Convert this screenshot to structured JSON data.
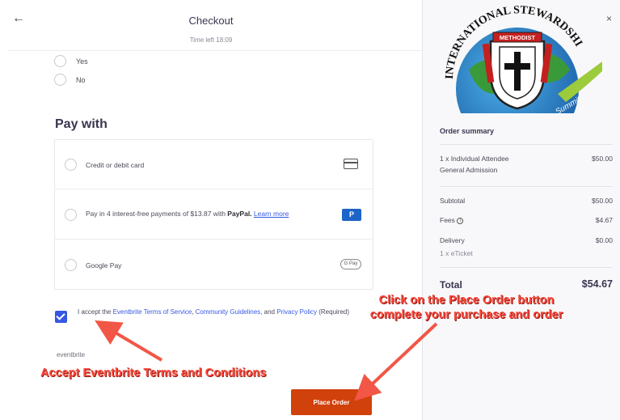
{
  "header": {
    "title": "Checkout",
    "time_left": "Time left 18:09",
    "back_icon": "arrow-left-icon"
  },
  "question": {
    "options": [
      "Yes",
      "No"
    ]
  },
  "payment": {
    "heading": "Pay with",
    "options": [
      {
        "label": "Credit or debit card",
        "icon": "credit-card-icon"
      },
      {
        "label_prefix": "Pay in 4 interest-free payments of $13.87 with ",
        "brand": "PayPal.",
        "link": "Learn more",
        "icon": "paypal-icon",
        "icon_text": "P"
      },
      {
        "label": "Google Pay",
        "icon": "google-pay-icon",
        "icon_text": "G Pay"
      }
    ]
  },
  "terms": {
    "checked": true,
    "prefix": "I accept the ",
    "link1": "Eventbrite Terms of Service",
    "sep1": ", ",
    "link2": "Community Guidelines",
    "sep2": ", and ",
    "link3": "Privacy Policy",
    "suffix": " (Required)"
  },
  "footer": {
    "brand": "eventbrite",
    "place_order": "Place Order"
  },
  "annotations": {
    "left": "Accept Eventbrite  Terms and Conditions",
    "right": "Click on the Place Order button complete your purchase and order",
    "color": "#ff4a3d"
  },
  "summary": {
    "logo_text_top": "INTERNATIONAL STEWARDSHIP &",
    "logo_text_ribbon": "Summit",
    "logo_banner": "METHODIST",
    "title": "Order summary",
    "item": {
      "name": "1 x Individual Attendee",
      "type": "General Admission",
      "amount": "$50.00"
    },
    "subtotal": {
      "label": "Subtotal",
      "amount": "$50.00"
    },
    "fees": {
      "label": "Fees",
      "icon": "info-icon",
      "amount": "$4.67"
    },
    "delivery": {
      "label": "Delivery",
      "detail": "1 x eTicket",
      "amount": "$0.00"
    },
    "total": {
      "label": "Total",
      "amount": "$54.67"
    }
  },
  "colors": {
    "accent": "#3659e3",
    "place_order": "#d1410c",
    "annotation": "#ff4a3d"
  }
}
